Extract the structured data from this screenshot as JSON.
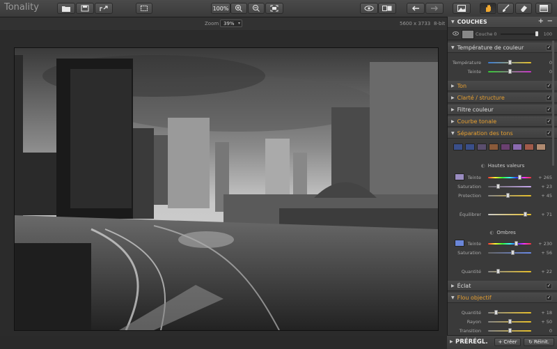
{
  "app": {
    "title": "Tonality"
  },
  "toolbar": {
    "zoom_pct": "100%"
  },
  "infobar": {
    "zoom_label": "Zoom",
    "zoom_value": "39%",
    "dimensions": "5600 x 3733",
    "bit_depth": "8-bit"
  },
  "layers": {
    "title": "COUCHES",
    "add": "+",
    "remove": "−",
    "layer_name": "Couche 0",
    "opacity": "100"
  },
  "temperature": {
    "title": "Température de couleur",
    "checked": "✓",
    "rows": [
      {
        "label": "Température",
        "value": "0",
        "gradient": [
          "#3a7bd5",
          "#e8c02a"
        ],
        "pos": 0.5
      },
      {
        "label": "Teinte",
        "value": "0",
        "gradient": [
          "#3c3",
          "#c3c"
        ],
        "pos": 0.5
      }
    ]
  },
  "sections_top": [
    {
      "title": "Ton",
      "orange": true
    },
    {
      "title": "Clarté / structure",
      "orange": true
    },
    {
      "title": "Filtre couleur",
      "orange": false
    },
    {
      "title": "Courbe tonale",
      "orange": true
    },
    {
      "title": "Séparation des tons",
      "orange": true,
      "open": true
    }
  ],
  "split_toning": {
    "presets": [
      "#3a4f8a",
      "#3a4f8a",
      "#5a4e6e",
      "#8a5a3a",
      "#6a4070",
      "#8a6ab0",
      "#a05a4a",
      "#b08a70"
    ],
    "highlights_title": "Hautes valeurs",
    "highlights_color": "#9a8cc0",
    "highlights": [
      {
        "label": "Teinte",
        "value": "+ 265",
        "gradient": [
          "#f33",
          "#ff3",
          "#3f3",
          "#3ff",
          "#33f",
          "#f3f",
          "#f33"
        ],
        "pos": 0.73
      },
      {
        "label": "Saturation",
        "value": "+ 23",
        "gradient": [
          "#666",
          "#c8a8f0"
        ],
        "pos": 0.23
      },
      {
        "label": "Protection",
        "value": "+ 45",
        "gradient": [
          "#888",
          "#e8c02a"
        ],
        "pos": 0.45
      }
    ],
    "balance": {
      "label": "Équilibrer",
      "value": "+ 71",
      "gradient": [
        "#ccc",
        "#e8c02a"
      ],
      "pos": 0.85
    },
    "shadows_title": "Ombres",
    "shadows_color": "#6a86d8",
    "shadows": [
      {
        "label": "Teinte",
        "value": "+ 230",
        "gradient": [
          "#f33",
          "#ff3",
          "#3f3",
          "#3ff",
          "#33f",
          "#f3f",
          "#f33"
        ],
        "pos": 0.64
      },
      {
        "label": "Saturation",
        "value": "+ 56",
        "gradient": [
          "#666",
          "#6a8ae8"
        ],
        "pos": 0.56
      }
    ],
    "amount": {
      "label": "Quantité",
      "value": "+ 22",
      "gradient": [
        "#888",
        "#e8c02a"
      ],
      "pos": 0.22
    }
  },
  "eclat": {
    "title": "Éclat",
    "orange": false
  },
  "blur": {
    "title": "Flou objectif",
    "orange": true,
    "rows": [
      {
        "label": "Quantité",
        "value": "+ 18",
        "gradient": [
          "#888",
          "#e8c02a"
        ],
        "pos": 0.18
      },
      {
        "label": "Rayon",
        "value": "+ 50",
        "gradient": [
          "#888",
          "#e8c02a"
        ],
        "pos": 0.5
      },
      {
        "label": "Transition",
        "value": "0",
        "gradient": [
          "#888",
          "#e8c02a"
        ],
        "pos": 0.5
      }
    ]
  },
  "presets_bar": {
    "title": "PRÉRÉGL.",
    "create": "Créer",
    "reset": "Réinit."
  }
}
